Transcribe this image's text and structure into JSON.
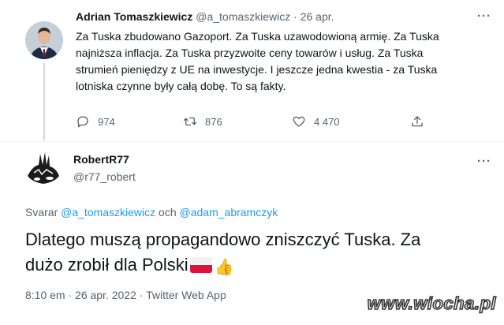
{
  "tweet1": {
    "name": "Adrian Tomaszkiewicz",
    "handle": "@a_tomaszkiewicz",
    "separator": "·",
    "date": "26 apr.",
    "text_lines": [
      "Za Tuska zbudowano Gazoport. Za Tuska uzawodowioną armię. Za Tuska",
      "najniższa inflacja. Za Tuska przyzwoite ceny towarów i usług. Za Tuska",
      "strumień pieniędzy z UE na inwestycje. I jeszcze jedna kwestia - za Tuska",
      "lotniska czynne były całą dobę. To są fakty."
    ],
    "replies": "974",
    "retweets": "876",
    "likes": "4 470",
    "more": "···"
  },
  "tweet2": {
    "name": "RobertR77",
    "handle": "@r77_robert",
    "more": "···",
    "reply_prefix": "Svarar",
    "reply_mention1": "@a_tomaszkiewicz",
    "reply_and": "och",
    "reply_mention2": "@adam_abramczyk",
    "text_line1": "Dlatego muszą propagandowo zniszczyć Tuska. Za",
    "text_line2": "dużo zrobił dla Polski",
    "meta": "8:10 em · 26 apr. 2022 · Twitter Web App"
  },
  "watermark": "www.wiocha.pl",
  "icons": {
    "reply": "reply-icon",
    "retweet": "retweet-icon",
    "like": "like-icon",
    "share": "share-icon",
    "flag": "poland-flag-icon",
    "thumb": "thumbs-up-icon"
  },
  "colors": {
    "link": "#1d9bf0",
    "secondary_text": "#536471",
    "primary_text": "#0f1419"
  }
}
